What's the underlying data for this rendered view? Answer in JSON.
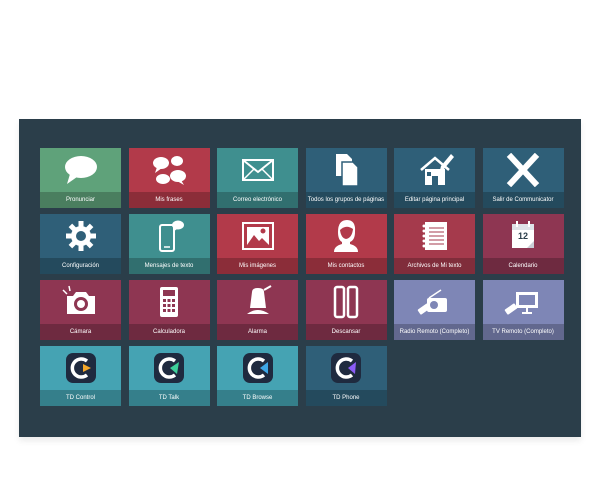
{
  "colors": {
    "background": "#2b3e4a",
    "green": "#5fa27a",
    "red": "#b23a4a",
    "teal": "#3f8f8f",
    "navy": "#2f5f78",
    "crimson": "#a53a4c",
    "plum": "#8e3652",
    "lavender": "#7e86b6",
    "cyan": "#45a3b3"
  },
  "tiles": [
    {
      "label": "Pronunciar",
      "icon": "speech-bubble-icon"
    },
    {
      "label": "Mis frases",
      "icon": "chat-bubbles-icon"
    },
    {
      "label": "Correo electrónico",
      "icon": "envelope-icon"
    },
    {
      "label": "Todos los grupos de páginas",
      "icon": "pages-icon"
    },
    {
      "label": "Editar página principal",
      "icon": "home-edit-icon"
    },
    {
      "label": "Salir de Communicator",
      "icon": "close-icon"
    },
    {
      "label": "Configuración",
      "icon": "gear-icon"
    },
    {
      "label": "Mensajes de texto",
      "icon": "phone-message-icon"
    },
    {
      "label": "Mis imágenes",
      "icon": "picture-icon"
    },
    {
      "label": "Mis contactos",
      "icon": "contact-icon"
    },
    {
      "label": "Archivos de Mi texto",
      "icon": "notebook-icon"
    },
    {
      "label": "Calendario",
      "icon": "calendar-icon",
      "day": "12"
    },
    {
      "label": "Cámara",
      "icon": "camera-icon"
    },
    {
      "label": "Calculadora",
      "icon": "calculator-icon"
    },
    {
      "label": "Alarma",
      "icon": "bell-icon"
    },
    {
      "label": "Descansar",
      "icon": "pause-icon"
    },
    {
      "label": "Radio Remoto (Completo)",
      "icon": "radio-remote-icon"
    },
    {
      "label": "TV Remoto (Completo)",
      "icon": "tv-remote-icon"
    },
    {
      "label": "TD Control",
      "icon": "td-control-logo-icon"
    },
    {
      "label": "TD Talk",
      "icon": "td-talk-logo-icon"
    },
    {
      "label": "TD Browse",
      "icon": "td-browse-logo-icon"
    },
    {
      "label": "TD Phone",
      "icon": "td-phone-logo-icon"
    }
  ]
}
